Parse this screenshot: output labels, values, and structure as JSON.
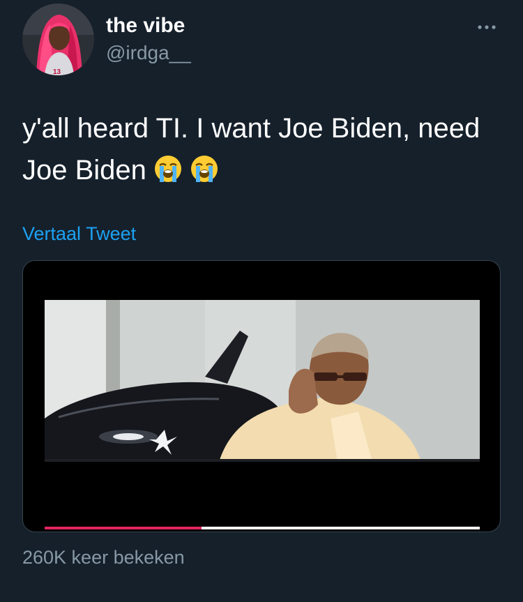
{
  "tweet": {
    "author": {
      "display_name": "the vibe",
      "handle": "@irdga__",
      "avatar_icon": "profile-photo"
    },
    "menu_icon": "more-options-icon",
    "text_lines": [
      "y'all heard TI. I want Joe Biden, need",
      "Joe Biden"
    ],
    "emojis": [
      "😭",
      "😭"
    ],
    "translate_label": "Vertaal Tweet",
    "media": {
      "type": "video",
      "progress": 0.36,
      "progress_color": "#e0245e"
    },
    "view_count": "260K keer bekeken"
  },
  "theme": {
    "background": "#15202b",
    "text": "#ffffff",
    "secondary_text": "#8899a6",
    "link": "#1da1f2",
    "border": "#38444d"
  }
}
